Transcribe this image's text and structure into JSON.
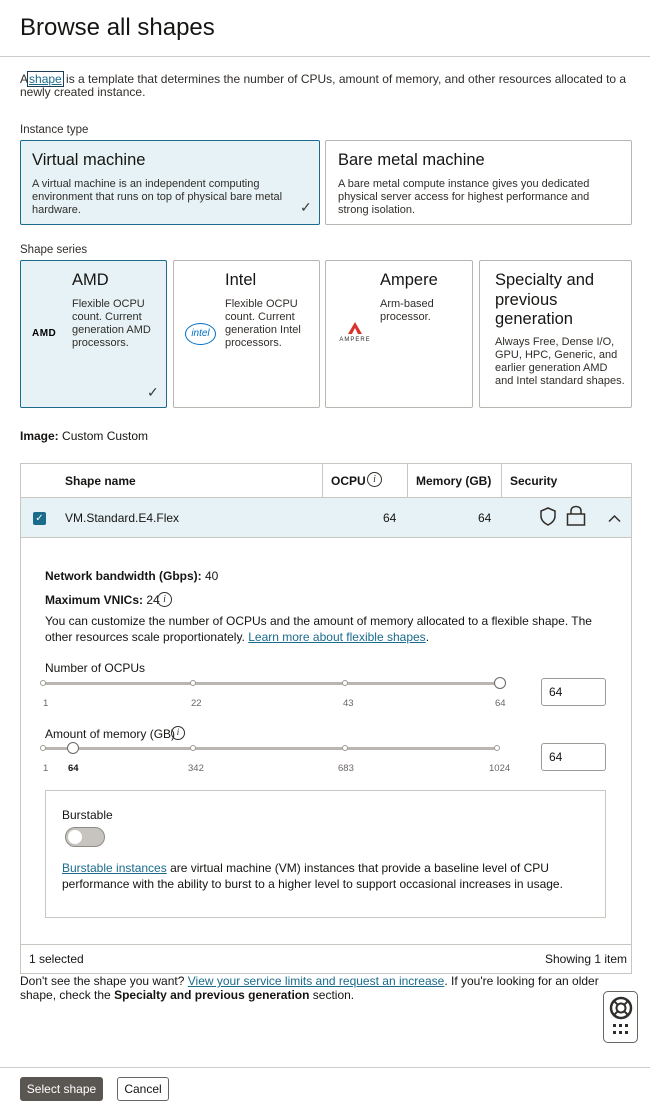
{
  "page": {
    "title": "Browse all shapes"
  },
  "intro": {
    "prefix": "A",
    "link": "shape",
    "rest": " is a template that determines the number of CPUs, amount of memory, and other resources allocated to a newly created instance."
  },
  "instance_type": {
    "label": "Instance type",
    "options": [
      {
        "title": "Virtual machine",
        "desc": "A virtual machine is an independent computing environment that runs on top of physical bare metal hardware.",
        "selected": true
      },
      {
        "title": "Bare metal machine",
        "desc": "A bare metal compute instance gives you dedicated physical server access for highest performance and strong isolation.",
        "selected": false
      }
    ]
  },
  "shape_series": {
    "label": "Shape series",
    "options": [
      {
        "title": "AMD",
        "desc": "Flexible OCPU count. Current generation AMD processors.",
        "logo": "AMD",
        "selected": true
      },
      {
        "title": "Intel",
        "desc": "Flexible OCPU count. Current generation Intel processors.",
        "logo": "intel",
        "selected": false
      },
      {
        "title": "Ampere",
        "desc": "Arm-based processor.",
        "logo": "AMPERE",
        "selected": false
      },
      {
        "title": "Specialty and previous generation",
        "desc": "Always Free, Dense I/O, GPU, HPC, Generic, and earlier generation AMD and Intel standard shapes.",
        "selected": false
      }
    ]
  },
  "image": {
    "label": "Image:",
    "value": "Custom Custom"
  },
  "table": {
    "headers": {
      "name": "Shape name",
      "ocpu": "OCPU",
      "memory": "Memory (GB)",
      "security": "Security"
    },
    "row": {
      "name": "VM.Standard.E4.Flex",
      "ocpu": "64",
      "memory": "64"
    },
    "footer": {
      "selected": "1 selected",
      "showing": "Showing 1 item"
    }
  },
  "details": {
    "bandwidth_label": "Network bandwidth (Gbps):",
    "bandwidth_value": "40",
    "vnics_label": "Maximum VNICs:",
    "vnics_value": "24",
    "customize_text": "You can customize the number of OCPUs and the amount of memory allocated to a flexible shape. The other resources scale proportionately.",
    "learn_more": "Learn more about flexible shapes",
    "ocpu_slider": {
      "label": "Number of OCPUs",
      "ticks": [
        "1",
        "22",
        "43",
        "64"
      ],
      "value": "64",
      "fraction": 1.0
    },
    "memory_slider": {
      "label": "Amount of memory (GB)",
      "ticks": [
        "1",
        "64",
        "342",
        "683",
        "1024"
      ],
      "value": "64",
      "fraction": 0.0616
    },
    "burstable": {
      "label": "Burstable",
      "enabled": false,
      "link": "Burstable instances",
      "text": " are virtual machine (VM) instances that provide a baseline level of CPU performance with the ability to burst to a higher level to support occasional increases in usage."
    }
  },
  "limits": {
    "prefix": "Don't see the shape you want? ",
    "link": "View your service limits and request an increase",
    "middle": ". If you're looking for an older shape, check the ",
    "bold": "Specialty and previous generation",
    "suffix": " section."
  },
  "buttons": {
    "primary": "Select shape",
    "secondary": "Cancel"
  },
  "colors": {
    "accent": "#1a6b8c",
    "selected_bg": "#e6f2f5",
    "primary_btn": "#5a5652",
    "amd": "#000000",
    "intel": "#0071c5",
    "ampere": "#d9342b"
  }
}
